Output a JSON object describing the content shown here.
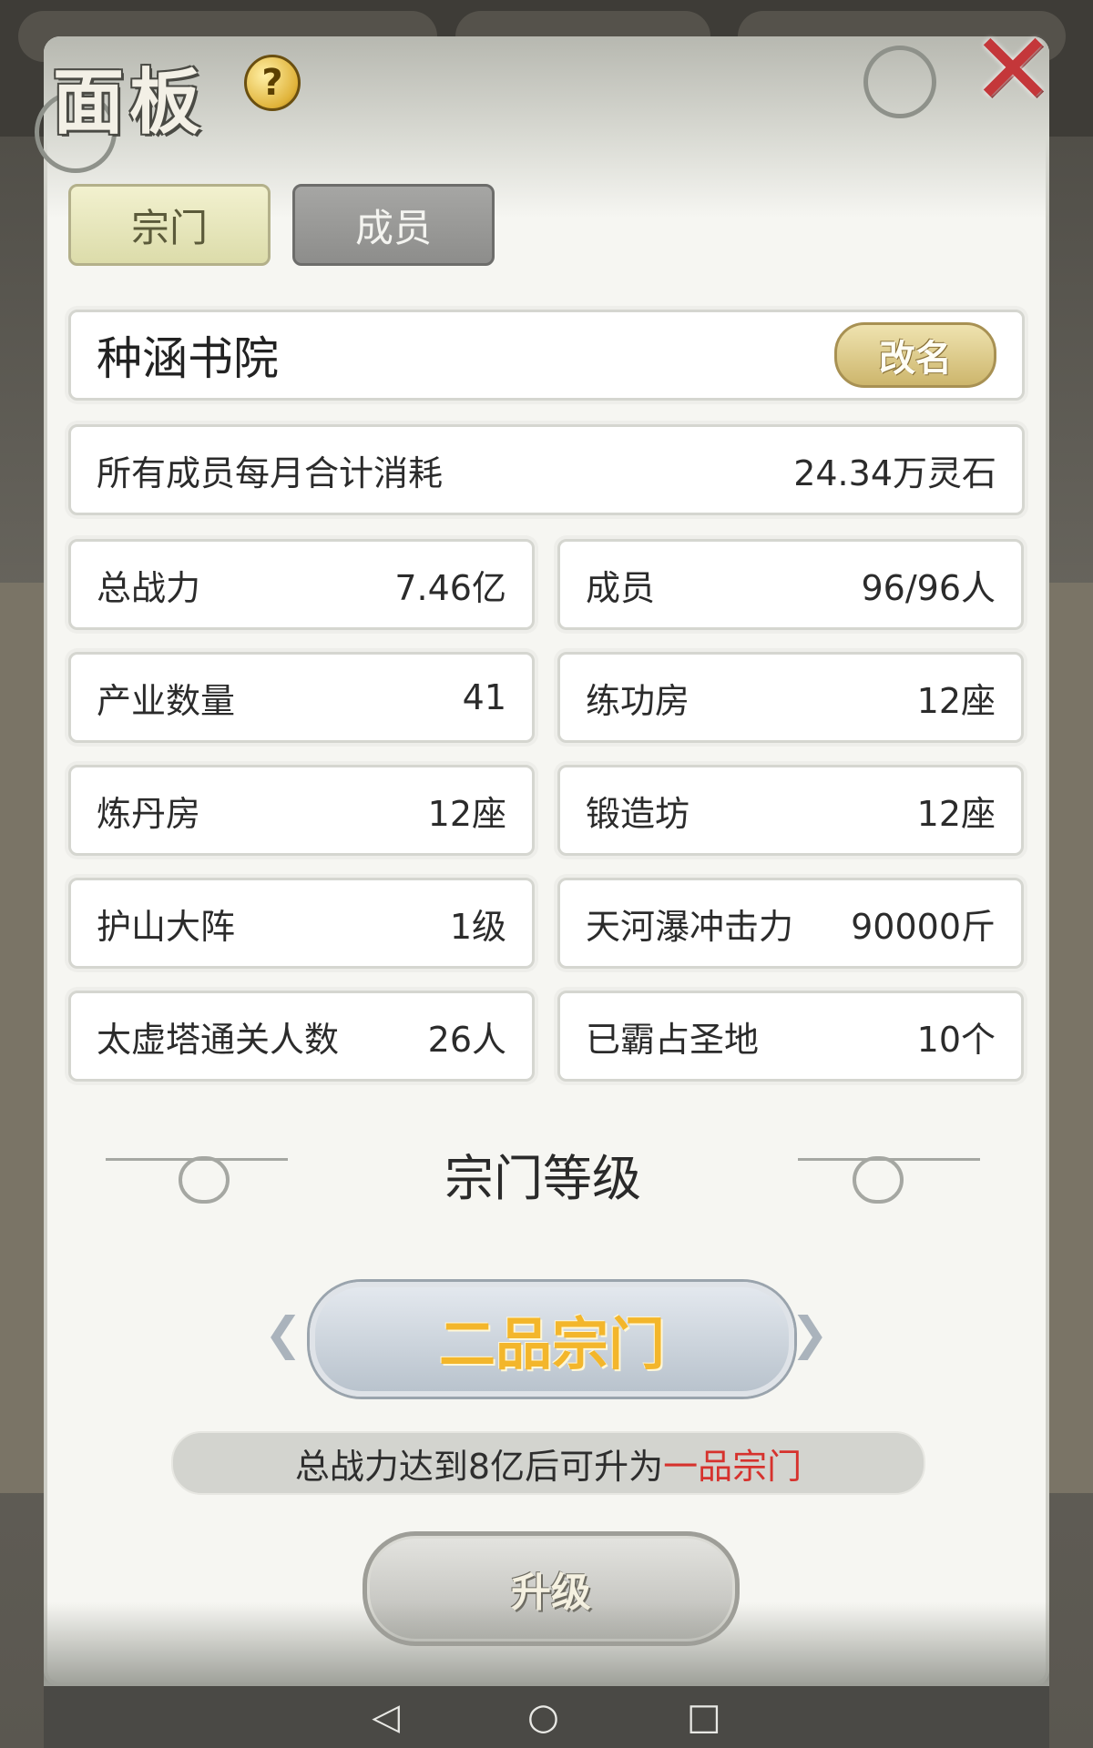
{
  "panel": {
    "title": "面板",
    "help_icon": "question-icon",
    "close_icon": "close-icon"
  },
  "tabs": [
    {
      "label": "宗门",
      "active": true
    },
    {
      "label": "成员",
      "active": false
    }
  ],
  "sect": {
    "name": "种涵书院",
    "rename_label": "改名"
  },
  "consumption": {
    "label": "所有成员每月合计消耗",
    "value": "24.34万灵石"
  },
  "stats": [
    {
      "label": "总战力",
      "value": "7.46亿"
    },
    {
      "label": "成员",
      "value": "96/96人"
    },
    {
      "label": "产业数量",
      "value": "41"
    },
    {
      "label": "练功房",
      "value": "12座"
    },
    {
      "label": "炼丹房",
      "value": "12座"
    },
    {
      "label": "锻造坊",
      "value": "12座"
    },
    {
      "label": "护山大阵",
      "value": "1级"
    },
    {
      "label": "天河瀑冲击力",
      "value": "90000斤"
    },
    {
      "label": "太虚塔通关人数",
      "value": "26人"
    },
    {
      "label": "已霸占圣地",
      "value": "10个"
    }
  ],
  "level": {
    "section_title": "宗门等级",
    "current_rank": "二品宗门",
    "requirement_prefix": "总战力达到8亿后可升为",
    "requirement_target": "一品宗门",
    "upgrade_label": "升级"
  },
  "colors": {
    "rank_text": "#f3b62b",
    "highlight_red": "#d6322d",
    "active_tab": "#e8e7bf",
    "inactive_tab": "#9a9a98"
  },
  "navbar": {
    "back_icon": "◁",
    "home_icon": "○",
    "recents_icon": "□"
  }
}
